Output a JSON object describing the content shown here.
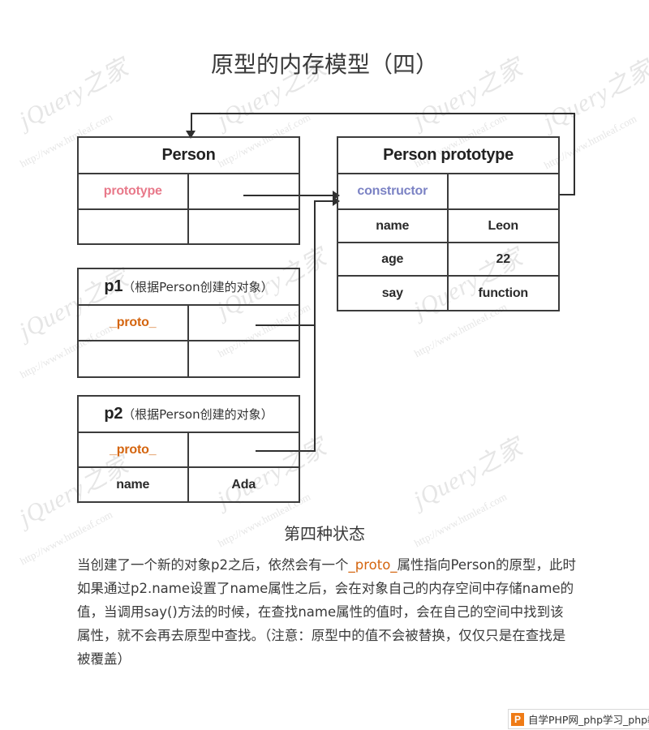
{
  "page": {
    "title": "原型的内存模型（四）",
    "caption": "第四种状态"
  },
  "diagram": {
    "person": {
      "header": "Person",
      "rows": [
        {
          "key": "prototype",
          "value": "",
          "key_color": "#e8798a"
        },
        {
          "key": "",
          "value": ""
        }
      ]
    },
    "person_prototype": {
      "header": "Person prototype",
      "rows": [
        {
          "key": "constructor",
          "value": "",
          "key_color": "#7b82c4"
        },
        {
          "key": "name",
          "value": "Leon"
        },
        {
          "key": "age",
          "value": "22"
        },
        {
          "key": "say",
          "value": "function"
        }
      ]
    },
    "p1": {
      "header_main": "p1",
      "header_sub": "（根据Person创建的对象）",
      "rows": [
        {
          "key": "_proto_",
          "value": "",
          "key_color": "#d4650f"
        },
        {
          "key": "",
          "value": ""
        }
      ]
    },
    "p2": {
      "header_main": "p2",
      "header_sub": "（根据Person创建的对象）",
      "rows": [
        {
          "key": "_proto_",
          "value": "",
          "key_color": "#d4650f"
        },
        {
          "key": "name",
          "value": "Ada"
        }
      ]
    }
  },
  "description": {
    "line1_a": "当创建了一个新的对象p2之后，依然会有一个",
    "line1_hl": "_proto_",
    "line1_b": "属性指向Person的原型，此时如果通过p2.name设置了name属性之后，会在对象自己的内存空间中存储name的值，当调用say()方法的时候，在查找name属性的值时，会在自己的空间中找到该属性，就不会再去原型中查找。（注意：原型中的值不会被替换，仅仅只是在查找是被覆盖）"
  },
  "watermarks": {
    "brand": "jQuery之家",
    "url": "http://www.htmleaf.com"
  },
  "footer_badge": {
    "icon_letter": "P",
    "text": "自学PHP网_php学习_php教"
  }
}
